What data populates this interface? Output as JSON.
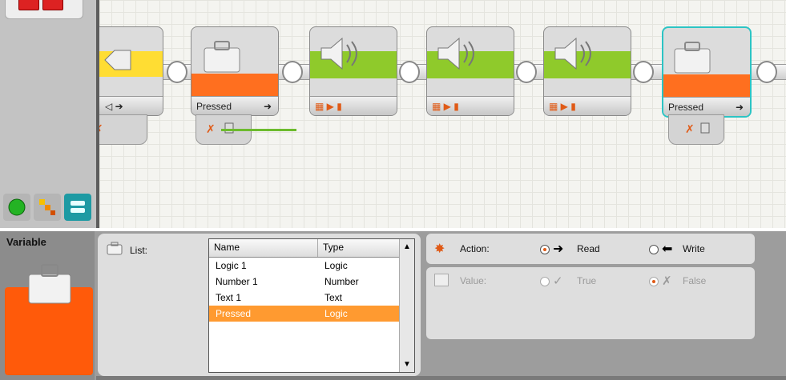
{
  "canvas": {
    "blocks": [
      {
        "type": "compare",
        "foot_label": ""
      },
      {
        "type": "variable",
        "foot_label": "Pressed"
      },
      {
        "type": "sound",
        "foot_label": ""
      },
      {
        "type": "sound",
        "foot_label": ""
      },
      {
        "type": "sound",
        "foot_label": ""
      },
      {
        "type": "variable",
        "foot_label": "Pressed"
      }
    ]
  },
  "palette": {
    "tabs": [
      "common-palette-icon",
      "complete-palette-icon",
      "custom-palette-icon"
    ]
  },
  "config": {
    "title": "Variable",
    "list_label": "List:",
    "table": {
      "columns": [
        "Name",
        "Type"
      ],
      "rows": [
        [
          "Logic 1",
          "Logic"
        ],
        [
          "Number 1",
          "Number"
        ],
        [
          "Text 1",
          "Text"
        ],
        [
          "Pressed",
          "Logic"
        ]
      ],
      "selected_index": 3
    },
    "action": {
      "label": "Action:",
      "read": "Read",
      "write": "Write",
      "selected": "Read"
    },
    "value": {
      "label": "Value:",
      "true_label": "True",
      "false_label": "False",
      "selected": "False",
      "disabled": true
    }
  },
  "colors": {
    "accent": "#ff6f1f",
    "selection": "#ff9a30",
    "sound": "#8fca2b",
    "compare": "#ffdd33",
    "highlight": "#2cc4c4"
  }
}
